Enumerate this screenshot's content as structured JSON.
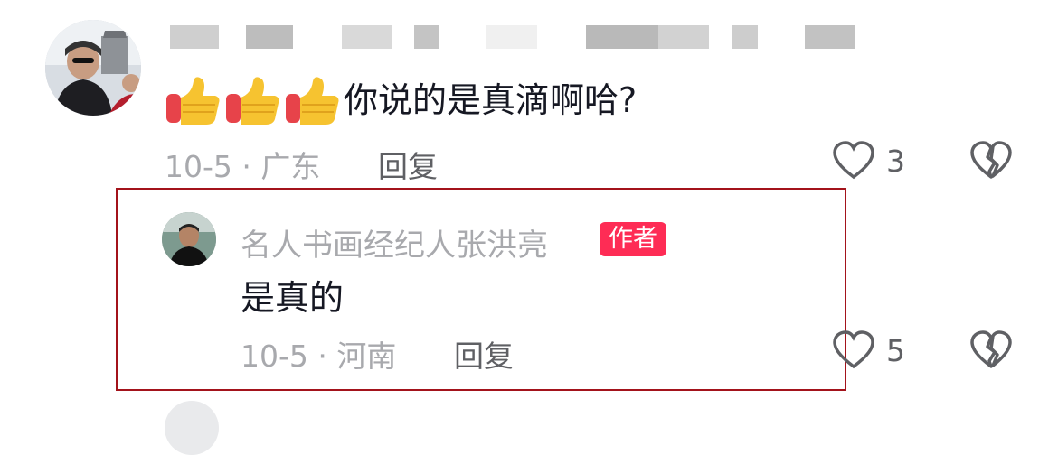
{
  "comments": [
    {
      "emojis": [
        "thumbs-up-emoji",
        "thumbs-up-emoji",
        "thumbs-up-emoji"
      ],
      "text": "你说的是真滴啊哈?",
      "date_location": "10-5 · 广东",
      "reply_label": "回复",
      "like_count": "3"
    }
  ],
  "reply": {
    "author": "名人书画经纪人张洪亮",
    "badge": "作者",
    "text": "是真的",
    "date_location": "10-5 · 河南",
    "reply_label": "回复",
    "like_count": "5"
  },
  "colors": {
    "badge_bg": "#fe2c55",
    "highlight_border": "#a3131b",
    "meta_text": "#a8a9ad"
  }
}
